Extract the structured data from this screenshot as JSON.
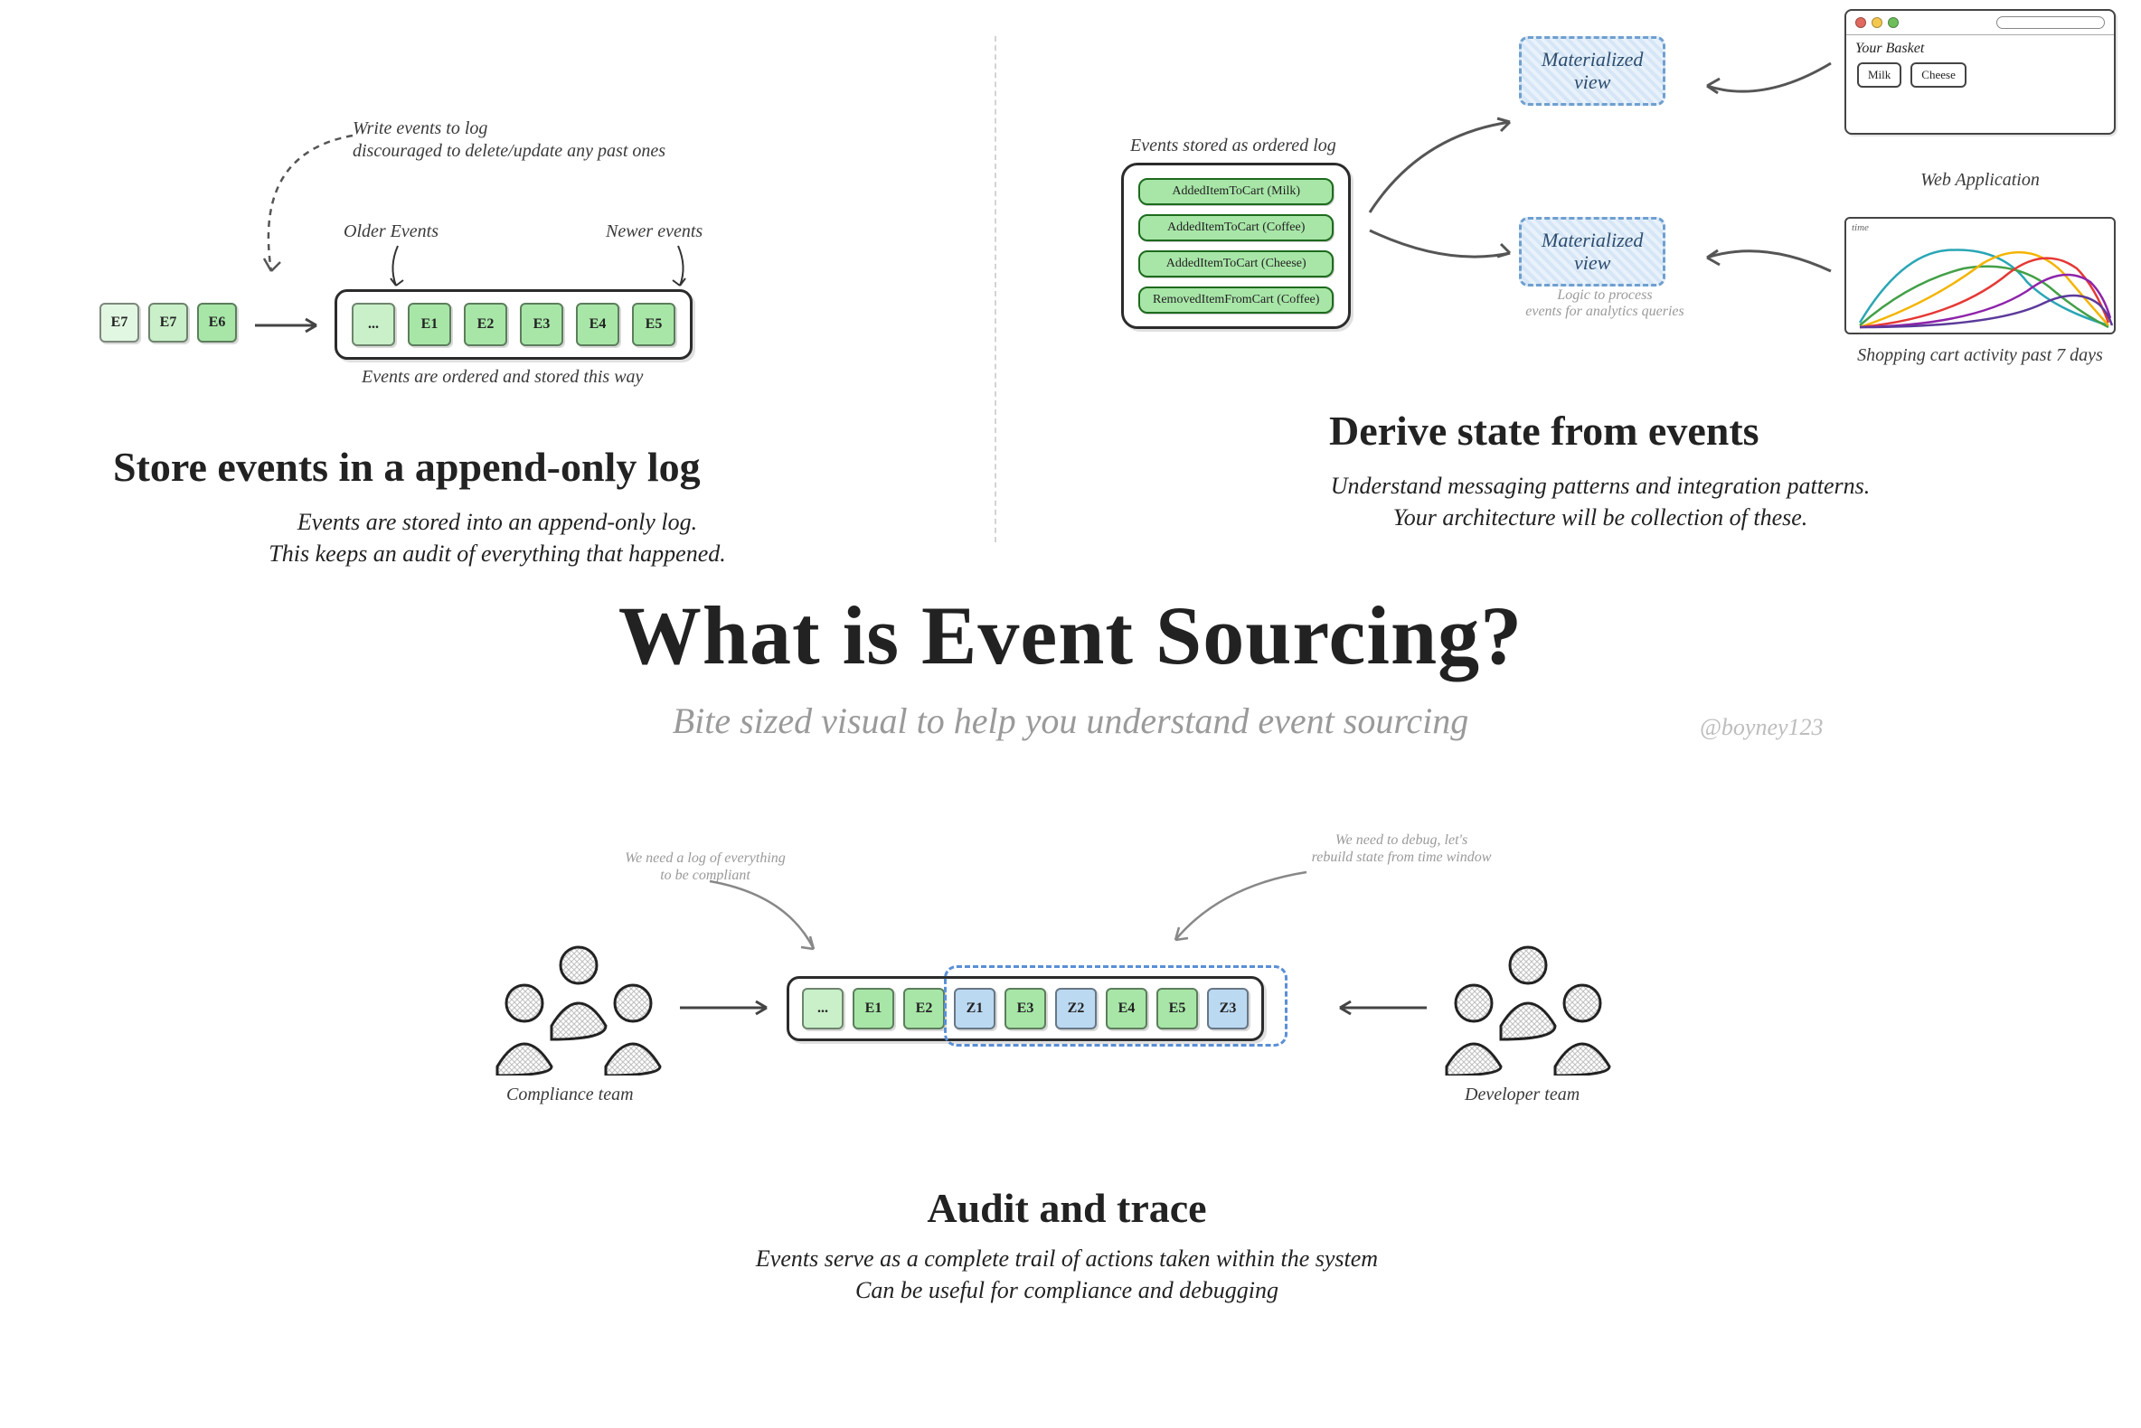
{
  "main": {
    "title": "What is Event Sourcing?",
    "subtitle": "Bite sized visual to help you understand event sourcing",
    "twitter": "@boyney123"
  },
  "section1": {
    "title": "Store events in a append-only log",
    "desc_line1": "Events are stored into an append-only log.",
    "desc_line2": "This keeps an audit of everything that happened.",
    "note_line1": "Write events to log",
    "note_line2": "discouraged to delete/update any past ones",
    "label_older": "Older Events",
    "label_newer": "Newer events",
    "caption": "Events are ordered and stored this way",
    "incoming": [
      "E7",
      "E7",
      "E6"
    ],
    "log": [
      "...",
      "E1",
      "E2",
      "E3",
      "E4",
      "E5"
    ]
  },
  "section2": {
    "title": "Derive state from events",
    "desc_line1": "Understand messaging patterns and integration patterns.",
    "desc_line2": "Your architecture will be collection of these.",
    "log_caption": "Events stored as ordered log",
    "events": [
      "AddedItemToCart (Milk)",
      "AddedItemToCart (Coffee)",
      "AddedItemToCart (Cheese)",
      "RemovedItemFromCart (Coffee)"
    ],
    "mat_view_label": "Materialized",
    "mat_view_label2": "view",
    "basket_title": "Your Basket",
    "basket_items": [
      "Milk",
      "Cheese"
    ],
    "web_app_label": "Web Application",
    "chart_axis": "time",
    "analytics_note_line1": "Logic to process",
    "analytics_note_line2": "events for analytics queries",
    "chart_caption": "Shopping cart activity past 7 days"
  },
  "section3": {
    "title": "Audit and trace",
    "desc_line1": "Events serve as a complete trail of actions taken within the system",
    "desc_line2": "Can be useful for compliance and debugging",
    "compliance_label": "Compliance team",
    "developer_label": "Developer team",
    "compliance_note_line1": "We need a log of everything",
    "compliance_note_line2": "to be compliant",
    "developer_note_line1": "We need to debug, let's",
    "developer_note_line2": "rebuild state from time window",
    "log": [
      {
        "t": "...",
        "c": "g"
      },
      {
        "t": "E1",
        "c": "g"
      },
      {
        "t": "E2",
        "c": "g"
      },
      {
        "t": "Z1",
        "c": "b"
      },
      {
        "t": "E3",
        "c": "g"
      },
      {
        "t": "Z2",
        "c": "b"
      },
      {
        "t": "E4",
        "c": "g"
      },
      {
        "t": "E5",
        "c": "g"
      },
      {
        "t": "Z3",
        "c": "b"
      }
    ]
  }
}
